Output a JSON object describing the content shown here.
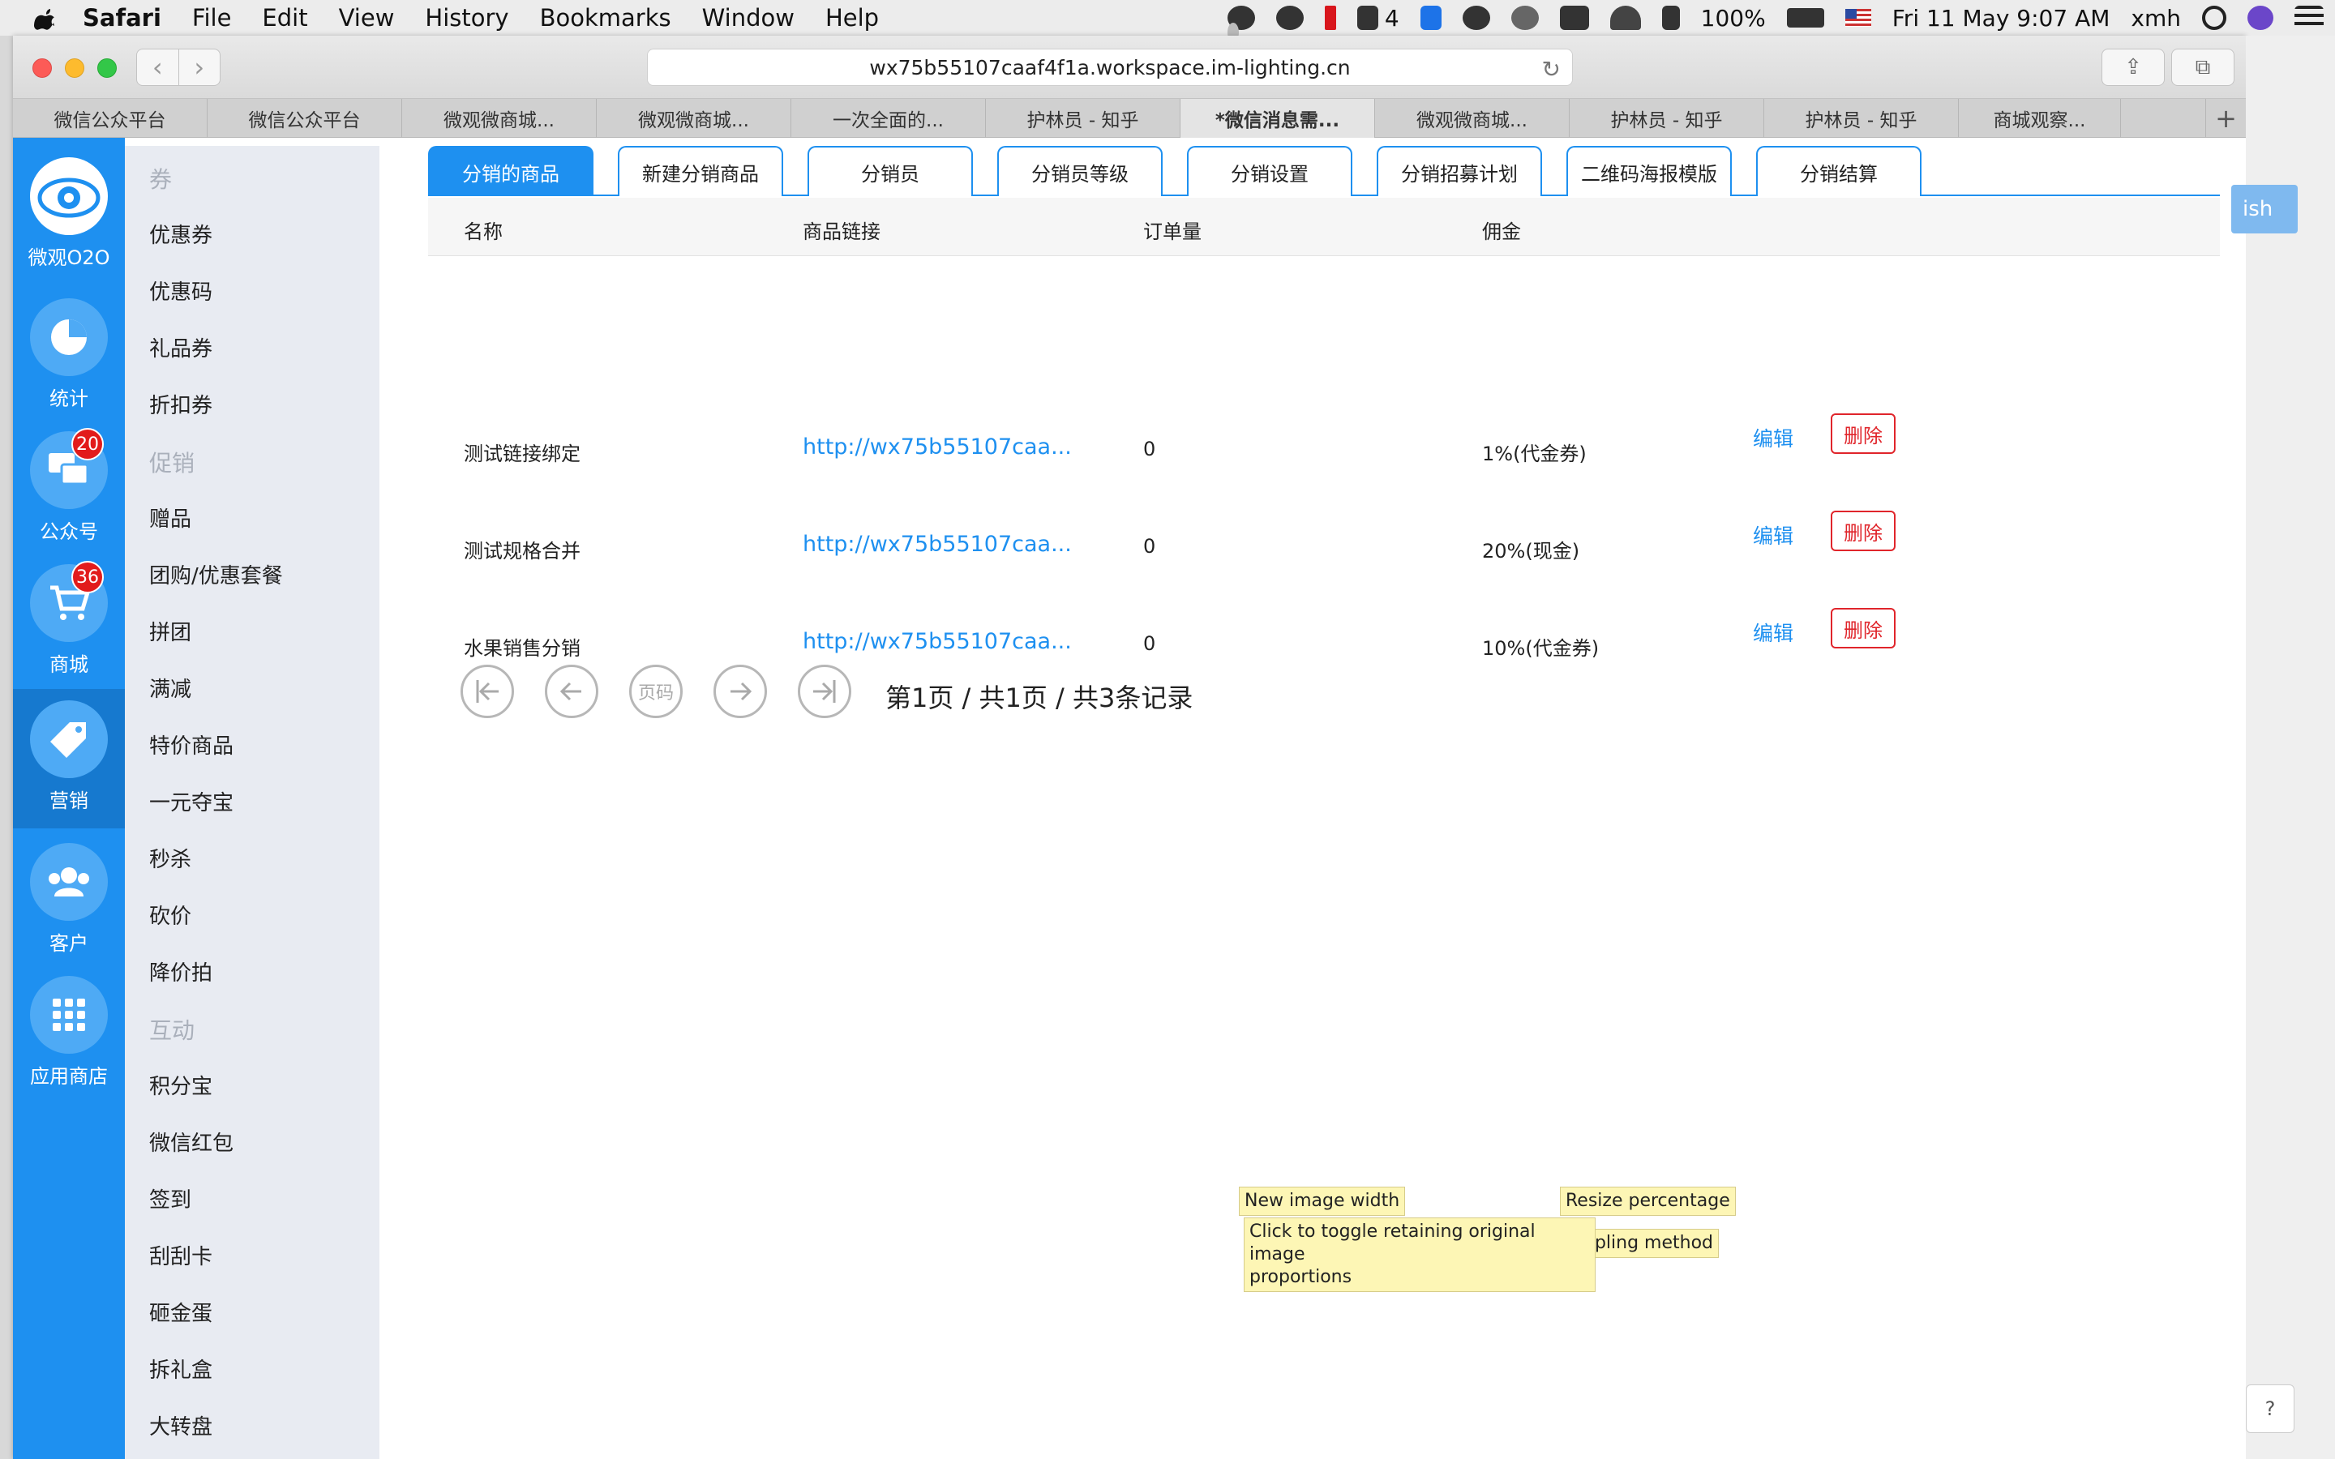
{
  "menubar": {
    "app": "Safari",
    "items": [
      "File",
      "Edit",
      "View",
      "History",
      "Bookmarks",
      "Window",
      "Help"
    ],
    "status_count": "4",
    "battery": "100%",
    "datetime": "Fri 11 May  9:07 AM",
    "user": "xmh"
  },
  "browser": {
    "url": "wx75b55107caaf4f1a.workspace.im-lighting.cn",
    "tabs": [
      {
        "label": "微信公众平台"
      },
      {
        "label": "微信公众平台"
      },
      {
        "label": "微观微商城..."
      },
      {
        "label": "微观微商城..."
      },
      {
        "label": "一次全面的..."
      },
      {
        "label": "护林员 - 知乎"
      },
      {
        "label": "*微信消息需...",
        "active": true
      },
      {
        "label": "微观微商城..."
      },
      {
        "label": "护林员 - 知乎"
      },
      {
        "label": "护林员 - 知乎"
      },
      {
        "label": "商城观察..."
      }
    ]
  },
  "leftnav": {
    "items": [
      {
        "label": "微观O2O",
        "icon": "eye-logo-icon"
      },
      {
        "label": "统计",
        "icon": "pie-chart-icon"
      },
      {
        "label": "公众号",
        "icon": "chat-icon",
        "badge": "20"
      },
      {
        "label": "商城",
        "icon": "cart-icon",
        "badge": "36"
      },
      {
        "label": "营销",
        "icon": "tag-icon",
        "active": true
      },
      {
        "label": "客户",
        "icon": "users-icon"
      },
      {
        "label": "应用商店",
        "icon": "apps-grid-icon"
      }
    ]
  },
  "subnav": {
    "groups": [
      {
        "title": "券",
        "items": [
          "优惠券",
          "优惠码",
          "礼品券",
          "折扣券"
        ]
      },
      {
        "title": "促销",
        "items": [
          "赠品",
          "团购/优惠套餐",
          "拼团",
          "满减",
          "特价商品",
          "一元夺宝",
          "秒杀",
          "砍价",
          "降价拍"
        ]
      },
      {
        "title": "互动",
        "items": [
          "积分宝",
          "微信红包",
          "签到",
          "刮刮卡",
          "砸金蛋",
          "拆礼盒",
          "大转盘"
        ]
      }
    ]
  },
  "main": {
    "tabs": [
      "分销的商品",
      "新建分销商品",
      "分销员",
      "分销员等级",
      "分销设置",
      "分销招募计划",
      "二维码海报模版",
      "分销结算"
    ],
    "table": {
      "headers": [
        "名称",
        "商品链接",
        "订单量",
        "佣金"
      ],
      "rows": [
        {
          "name": "测试链接绑定",
          "link": "http://wx75b55107caa...",
          "orders": "0",
          "commission": "1%(代金券)"
        },
        {
          "name": "测试规格合并",
          "link": "http://wx75b55107caa...",
          "orders": "0",
          "commission": "20%(现金)"
        },
        {
          "name": "水果销售分销",
          "link": "http://wx75b55107caa...",
          "orders": "0",
          "commission": "10%(代金券)"
        }
      ],
      "edit_label": "编辑",
      "delete_label": "删除"
    },
    "pager": {
      "page_input_label": "页码",
      "summary": "第1页  /  共1页  /  共3条记录"
    }
  },
  "tooltips": {
    "width": "New image width",
    "percent": "Resize percentage",
    "proportions_line1": "Click to toggle retaining original image",
    "proportions_line2": "proportions",
    "sampling": "pling method"
  },
  "rightside": {
    "button": "ish",
    "help": "?"
  }
}
